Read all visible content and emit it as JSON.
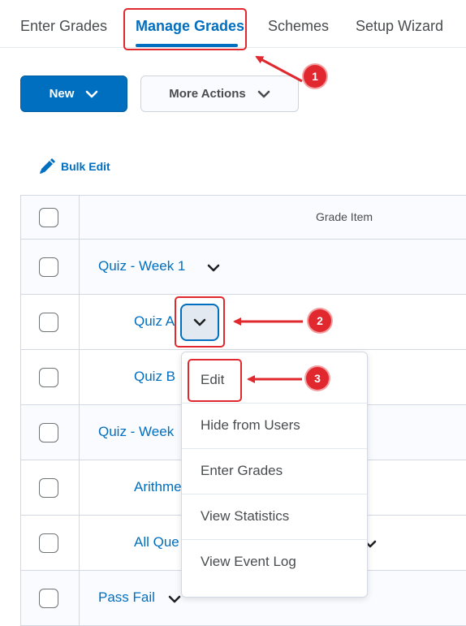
{
  "tabs": [
    {
      "label": "Enter Grades",
      "active": false
    },
    {
      "label": "Manage Grades",
      "active": true
    },
    {
      "label": "Schemes",
      "active": false
    },
    {
      "label": "Setup Wizard",
      "active": false
    }
  ],
  "toolbar": {
    "new_label": "New",
    "more_actions_label": "More Actions"
  },
  "bulk_edit_label": "Bulk Edit",
  "table": {
    "header": "Grade Item",
    "rows": [
      {
        "label": "Quiz - Week 1",
        "type": "category"
      },
      {
        "label": "Quiz A",
        "type": "item"
      },
      {
        "label": "Quiz B",
        "type": "item"
      },
      {
        "label": "Quiz - Week",
        "type": "category"
      },
      {
        "label": "Arithme",
        "type": "item"
      },
      {
        "label": "All Que",
        "type": "item"
      },
      {
        "label": "Pass Fail",
        "type": "category"
      }
    ]
  },
  "context_menu": {
    "items": [
      "Edit",
      "Hide from Users",
      "Enter Grades",
      "View Statistics",
      "View Event Log"
    ]
  },
  "annotations": {
    "badges": [
      "1",
      "2",
      "3"
    ],
    "color": "#e0282e"
  },
  "colors": {
    "accent": "#006fbf",
    "annotation": "#e0282e"
  }
}
